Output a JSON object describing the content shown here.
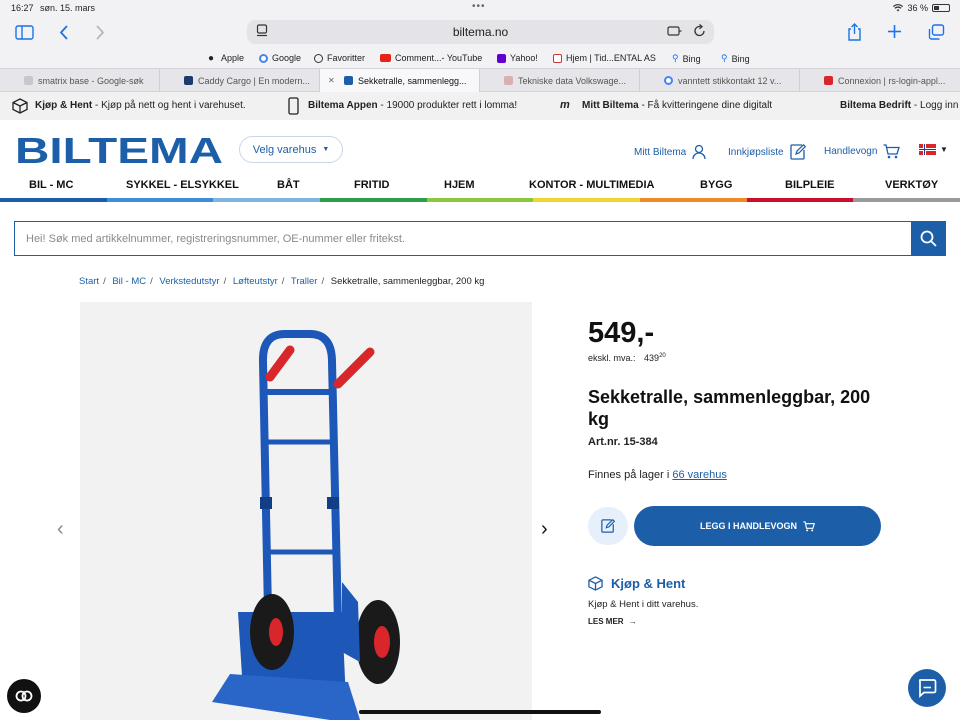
{
  "status": {
    "time": "16:27",
    "date": "søn. 15. mars",
    "battery": "36 %"
  },
  "browser": {
    "url": "biltema.no"
  },
  "bookmarks": [
    {
      "label": "Apple",
      "icon": "apple-icon"
    },
    {
      "label": "Google",
      "icon": "google-icon"
    },
    {
      "label": "Favoritter",
      "icon": "globe-icon"
    },
    {
      "label": "Comment...- YouTube",
      "icon": "youtube-icon"
    },
    {
      "label": "Yahoo!",
      "icon": "yahoo-icon"
    },
    {
      "label": "Hjem | Tid...ENTAL AS",
      "icon": "tidenental-icon"
    },
    {
      "label": "Bing",
      "icon": "search-icon"
    },
    {
      "label": "Bing",
      "icon": "search-icon"
    }
  ],
  "tabs": [
    {
      "label": "smatrix base - Google-søk",
      "active": false
    },
    {
      "label": "Caddy Cargo | En modern...",
      "active": false
    },
    {
      "label": "Sekketralle, sammenlegg...",
      "active": true
    },
    {
      "label": "Tekniske data Volkswage...",
      "active": false
    },
    {
      "label": "vanntett stikkontakt 12 v...",
      "active": false
    },
    {
      "label": "Connexion | rs-login-appl...",
      "active": false
    }
  ],
  "infobar": {
    "kh_bold": "Kjøp & Hent",
    "kh_text": " - Kjøp på nett og hent i varehuset.",
    "app_bold": "Biltema Appen",
    "app_text": " - 19000 produkter rett i lomma!",
    "mitt_bold": "Mitt Biltema",
    "mitt_text": " - Få kvitteringene dine digitalt",
    "bedrift_bold": "Biltema Bedrift",
    "bedrift_text": " - Logg inn"
  },
  "header": {
    "logo": "BILTEMA",
    "store_button": "Velg varehus",
    "mitt": "Mitt Biltema",
    "wishlist": "Innkjøpsliste",
    "cart": "Handlevogn"
  },
  "nav": [
    "BIL - MC",
    "SYKKEL - ELSYKKEL",
    "BÅT",
    "FRITID",
    "HJEM",
    "KONTOR - MULTIMEDIA",
    "BYGG",
    "BILPLEIE",
    "VERKTØY"
  ],
  "nav_colors": [
    "#1c5fa8",
    "#3c8fd6",
    "#7fb4de",
    "#2e9e4a",
    "#8cc63f",
    "#f3d532",
    "#f08a24",
    "#c8102e",
    "#9a9a9a"
  ],
  "search": {
    "placeholder": "Hei! Søk med artikkelnummer, registreringsnummer, OE-nummer eller fritekst."
  },
  "breadcrumb": [
    "Start",
    "Bil - MC",
    "Verkstedutstyr",
    "Løfteutstyr",
    "Traller"
  ],
  "breadcrumb_current": "Sekketralle, sammenleggbar, 200 kg",
  "product": {
    "price": "549,-",
    "exvat_label": "ekskl. mva.:",
    "exvat_int": "439",
    "exvat_dec": "20",
    "title": "Sekketralle, sammenleggbar, 200 kg",
    "artnr": "Art.nr. 15-384",
    "stock_text": "Finnes på lager i ",
    "stock_link": "66 varehus",
    "cart_button": "LEGG I HANDLEVOGN",
    "kh_title": "Kjøp & Hent",
    "kh_text": "Kjøp & Hent i ditt varehus.",
    "kh_more": "LES MER"
  }
}
